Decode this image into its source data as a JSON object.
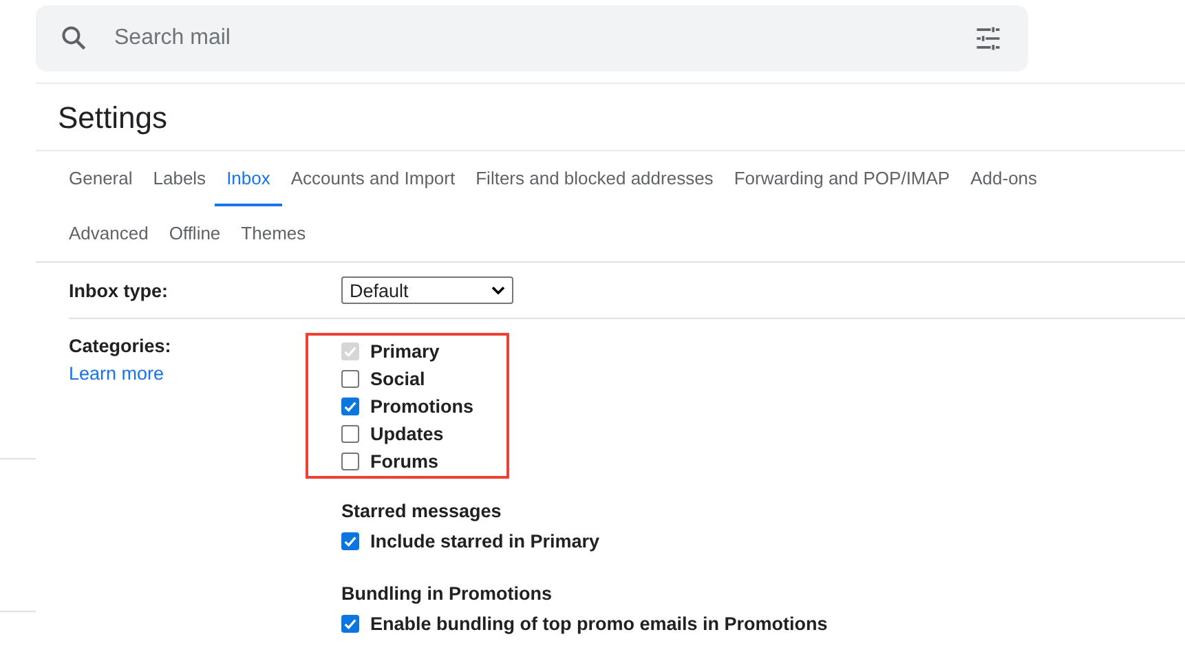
{
  "search": {
    "placeholder": "Search mail"
  },
  "title": "Settings",
  "tabs": [
    {
      "label": "General",
      "selected": false
    },
    {
      "label": "Labels",
      "selected": false
    },
    {
      "label": "Inbox",
      "selected": true
    },
    {
      "label": "Accounts and Import",
      "selected": false
    },
    {
      "label": "Filters and blocked addresses",
      "selected": false
    },
    {
      "label": "Forwarding and POP/IMAP",
      "selected": false
    },
    {
      "label": "Add-ons",
      "selected": false
    },
    {
      "label": "Advanced",
      "selected": false
    },
    {
      "label": "Offline",
      "selected": false
    },
    {
      "label": "Themes",
      "selected": false
    }
  ],
  "inbox_type": {
    "label": "Inbox type:",
    "value": "Default"
  },
  "categories": {
    "label": "Categories:",
    "link": "Learn more",
    "items": [
      {
        "label": "Primary",
        "checked": true,
        "disabled": true
      },
      {
        "label": "Social",
        "checked": false,
        "disabled": false
      },
      {
        "label": "Promotions",
        "checked": true,
        "disabled": false
      },
      {
        "label": "Updates",
        "checked": false,
        "disabled": false
      },
      {
        "label": "Forums",
        "checked": false,
        "disabled": false
      }
    ]
  },
  "sections": [
    {
      "heading": "Starred messages",
      "option": {
        "label": "Include starred in Primary",
        "checked": true
      }
    },
    {
      "heading": "Bundling in Promotions",
      "option": {
        "label": "Enable bundling of top promo emails in Promotions",
        "checked": true
      }
    }
  ]
}
